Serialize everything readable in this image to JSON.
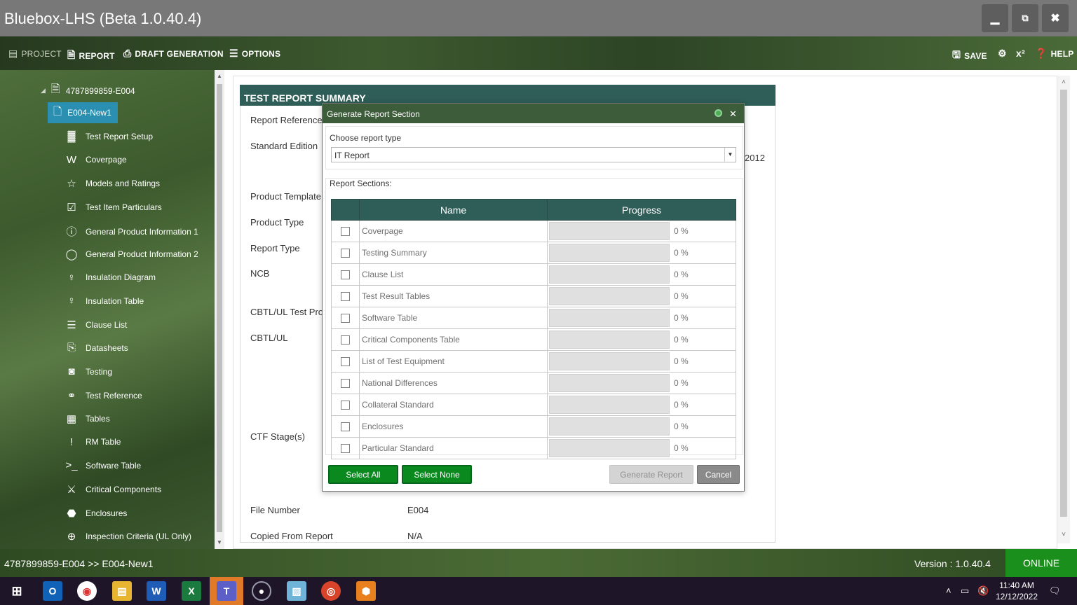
{
  "window": {
    "title": "Bluebox-LHS (Beta 1.0.40.4)",
    "minimize_icon": "minimize-icon",
    "restore_icon": "restore-icon",
    "close_icon": "close-icon"
  },
  "toolbar": {
    "project": "PROJECT",
    "report": "REPORT",
    "draft_generation": "DRAFT GENERATION",
    "options": "OPTIONS",
    "save": "SAVE",
    "superscript": "x²",
    "help": "HELP"
  },
  "tree": {
    "root": "4787899859-E004",
    "selected": "E004-New1",
    "items": [
      {
        "label": "Test Report Setup",
        "icon": "bar-chart-icon"
      },
      {
        "label": "Coverpage",
        "icon": "word-doc-icon"
      },
      {
        "label": "Models and Ratings",
        "icon": "star-icon"
      },
      {
        "label": "Test Item Particulars",
        "icon": "checkbox-icon"
      },
      {
        "label": "General Product Information 1",
        "icon": "info-icon"
      },
      {
        "label": "General Product Information 2",
        "icon": "chat-bubble-icon"
      },
      {
        "label": "Insulation Diagram",
        "icon": "thermometer-icon"
      },
      {
        "label": "Insulation Table",
        "icon": "thermometer-icon"
      },
      {
        "label": "Clause List",
        "icon": "list-icon"
      },
      {
        "label": "Datasheets",
        "icon": "copy-icon"
      },
      {
        "label": "Testing",
        "icon": "binoculars-icon"
      },
      {
        "label": "Test Reference",
        "icon": "link-icon"
      },
      {
        "label": "Tables",
        "icon": "table-icon"
      },
      {
        "label": "RM Table",
        "icon": "exclamation-icon"
      },
      {
        "label": "Software Table",
        "icon": "terminal-icon"
      },
      {
        "label": "Critical Components",
        "icon": "components-icon"
      },
      {
        "label": "Enclosures",
        "icon": "cubes-icon"
      },
      {
        "label": "Inspection Criteria  (UL Only)",
        "icon": "zoom-icon"
      }
    ]
  },
  "summary": {
    "header": "TEST REPORT SUMMARY",
    "fields": [
      {
        "label": "Report Reference"
      },
      {
        "label": "Standard Edition"
      },
      {
        "label": "Product Template"
      },
      {
        "label": "Product Type"
      },
      {
        "label": "Report Type"
      },
      {
        "label": "NCB"
      },
      {
        "label": "CBTL/UL Test Proc"
      },
      {
        "label": "CBTL/UL"
      },
      {
        "label": "CTF Stage(s)"
      },
      {
        "label": "File Number",
        "value": "E004"
      },
      {
        "label": "Copied From Report",
        "value": "N/A"
      }
    ],
    "partial_year": "2012"
  },
  "dialog": {
    "title": "Generate Report Section",
    "choose_label": "Choose report type",
    "report_type": "IT Report",
    "sections_label": "Report Sections:",
    "col_name": "Name",
    "col_progress": "Progress",
    "rows": [
      {
        "name": "Coverpage",
        "progress": 0,
        "pct": "0 %"
      },
      {
        "name": "Testing Summary",
        "progress": 0,
        "pct": "0 %"
      },
      {
        "name": "Clause List",
        "progress": 0,
        "pct": "0 %"
      },
      {
        "name": "Test Result Tables",
        "progress": 0,
        "pct": "0 %"
      },
      {
        "name": "Software Table",
        "progress": 0,
        "pct": "0 %"
      },
      {
        "name": "Critical Components Table",
        "progress": 0,
        "pct": "0 %"
      },
      {
        "name": "List of Test Equipment",
        "progress": 0,
        "pct": "0 %"
      },
      {
        "name": "National Differences",
        "progress": 0,
        "pct": "0 %"
      },
      {
        "name": "Collateral Standard",
        "progress": 0,
        "pct": "0 %"
      },
      {
        "name": "Enclosures",
        "progress": 0,
        "pct": "0 %"
      },
      {
        "name": "Particular Standard",
        "progress": 0,
        "pct": "0 %"
      }
    ],
    "select_all": "Select All",
    "select_none": "Select None",
    "generate": "Generate Report",
    "cancel": "Cancel"
  },
  "status": {
    "path": "4787899859-E004  >>  E004-New1",
    "version": "Version : 1.0.40.4",
    "online": "ONLINE"
  },
  "taskbar": {
    "time": "11:40 AM",
    "date": "12/12/2022"
  },
  "colors": {
    "header_teal": "#2f5d57",
    "dialog_title": "#3d5c3a",
    "button_green": "#0a8a1e",
    "online_green": "#1b8f1b",
    "tree_selected": "#2a8fb0"
  }
}
